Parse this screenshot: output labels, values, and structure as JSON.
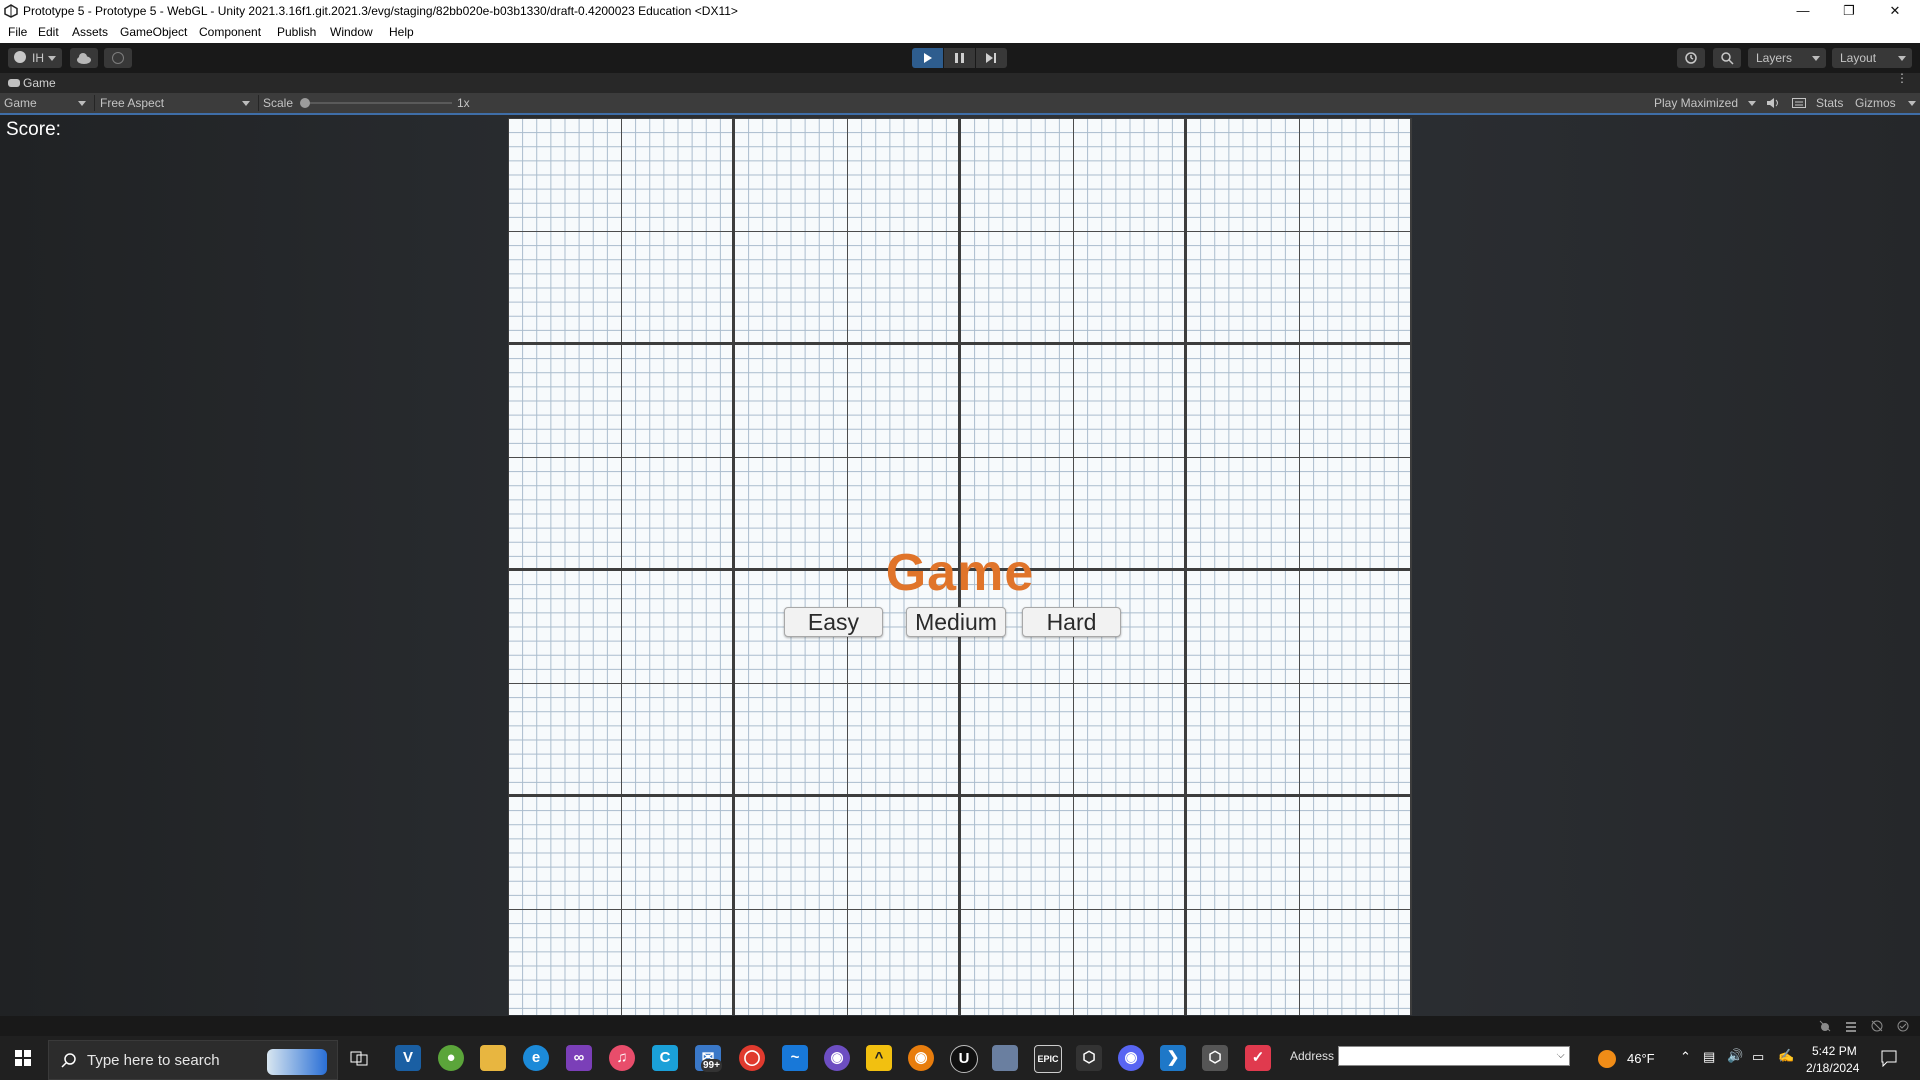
{
  "window": {
    "title": "Prototype 5 - Prototype 5 - WebGL - Unity 2021.3.16f1.git.2021.3/evg/staging/82bb020e-b03b1330/draft-0.4200023 Education <DX11>",
    "minimize_icon": "minimize-icon",
    "restore_icon": "restore-icon",
    "close_icon": "close-icon"
  },
  "menu": [
    "File",
    "Edit",
    "Assets",
    "GameObject",
    "Component",
    "Publish",
    "Window",
    "Help"
  ],
  "toolbar": {
    "account_label": "IH",
    "layers_label": "Layers",
    "layout_label": "Layout",
    "play_active": true
  },
  "game_tab": {
    "label": "Game",
    "display": "Game",
    "aspect": "Free Aspect",
    "scale_label": "Scale",
    "scale_value": "1x",
    "play_mode": "Play Maximized",
    "stats": "Stats",
    "gizmos": "Gizmos"
  },
  "game_view": {
    "score_label": "Score:",
    "title": "Game",
    "title_color": "#e0742a",
    "buttons": [
      "Easy",
      "Medium",
      "Hard"
    ]
  },
  "taskbar": {
    "search_placeholder": "Type here to search",
    "address_label": "Address",
    "weather": "46°F",
    "time": "5:42 PM",
    "date": "2/18/2024",
    "mail_badge": "99+"
  }
}
